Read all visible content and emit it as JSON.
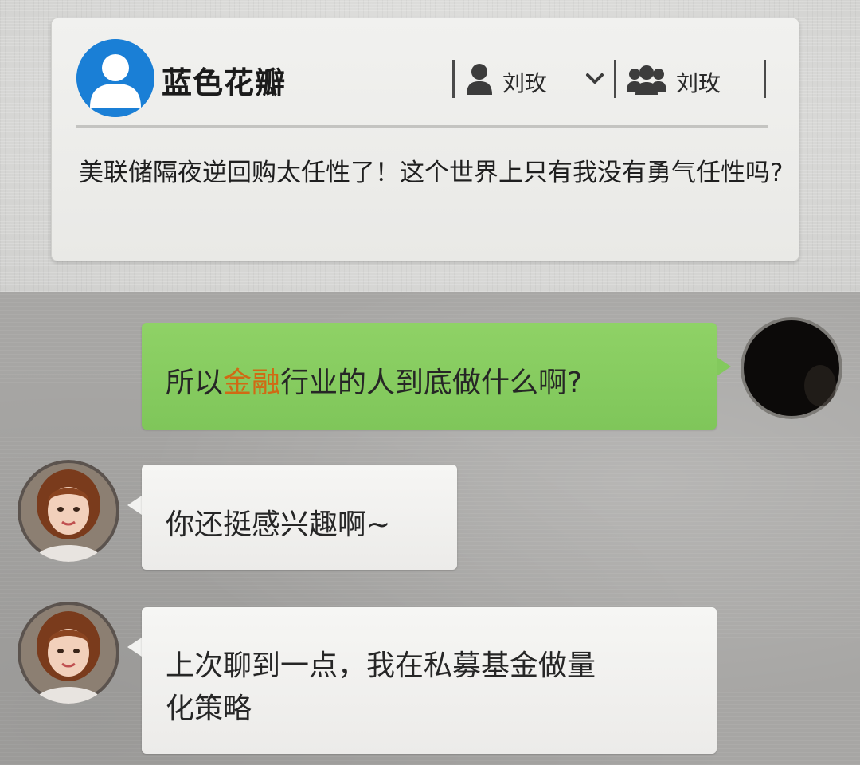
{
  "post_card": {
    "nickname": "蓝色花瓣",
    "meta": [
      {
        "icon": "user-icon",
        "name": "刘玫"
      },
      {
        "icon": "group-icon",
        "name": "刘玫"
      }
    ],
    "content": "美联储隔夜逆回购太任性了！这个世界上只有我没有勇气任性吗?"
  },
  "chat": {
    "messages": [
      {
        "sender": "me",
        "parts": [
          "所以",
          "金融",
          "行业的人到底做什么啊?"
        ],
        "highlight_color": "#d06a14"
      },
      {
        "sender": "other",
        "text": "你还挺感兴趣啊~"
      },
      {
        "sender": "other",
        "text_lines": [
          "上次聊到一点，我在私募基金做量",
          "化策略"
        ]
      }
    ]
  },
  "colors": {
    "avatar_blue": "#1a7fd6",
    "me_bubble": "#84ca5f",
    "other_bubble": "#f2f2f0",
    "highlight": "#d06a14"
  }
}
